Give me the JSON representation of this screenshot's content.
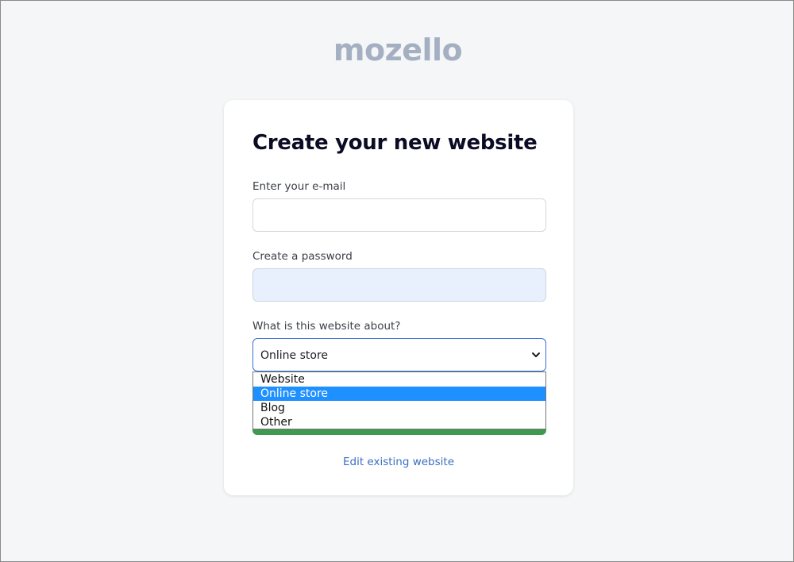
{
  "logo": {
    "text": "mozello",
    "color": "#a4b0c2"
  },
  "form": {
    "title": "Create your new website",
    "email": {
      "label": "Enter your e-mail",
      "value": "",
      "placeholder": ""
    },
    "password": {
      "label": "Create a password",
      "value": "",
      "placeholder": ""
    },
    "site_type": {
      "label": "What is this website about?",
      "selected": "Online store",
      "options": [
        "Website",
        "Online store",
        "Blog",
        "Other"
      ],
      "dropdown_open": true,
      "highlighted_index": 1
    },
    "submit_button": {
      "color": "#3f9a4f"
    },
    "edit_link": "Edit existing website"
  },
  "colors": {
    "background": "#f5f6f8",
    "title": "#0b0c24",
    "link": "#3b6fc0",
    "select_border": "#3b6fd4",
    "option_highlight": "#1e90ff"
  }
}
